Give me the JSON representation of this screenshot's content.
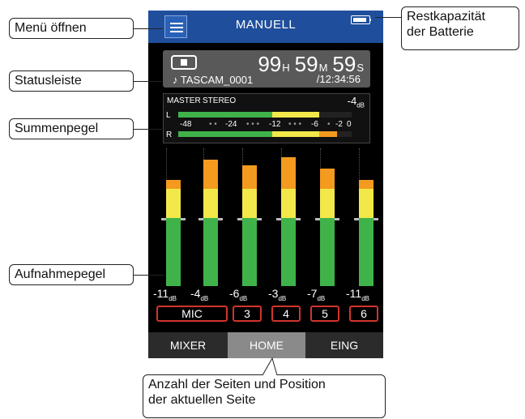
{
  "screen": {
    "title": "MANUELL",
    "time": {
      "h": "99",
      "h_unit": "H",
      "m": "59",
      "m_unit": "M",
      "s": "59",
      "s_unit": "S"
    },
    "file_name": "♪ TASCAM_0001",
    "total_time": "/12:34:56",
    "master": {
      "label": "MASTER",
      "mode": "STEREO",
      "level": "-4",
      "level_unit": "dB",
      "left_label": "L",
      "right_label": "R",
      "scale": [
        "-48",
        "-24",
        "-12",
        "-6",
        "-2",
        "0"
      ]
    },
    "channels": [
      {
        "value": "-11",
        "unit": "dB",
        "button": "MIC",
        "level": 0.0,
        "peak_db": -11
      },
      {
        "value": "-4",
        "unit": "dB",
        "button": "",
        "level": 0.0,
        "peak_db": -4
      },
      {
        "value": "-6",
        "unit": "dB",
        "button": "3",
        "level": 0.0,
        "peak_db": -6
      },
      {
        "value": "-3",
        "unit": "dB",
        "button": "4",
        "level": 0.0,
        "peak_db": -3
      },
      {
        "value": "-7",
        "unit": "dB",
        "button": "5",
        "level": 0.0,
        "peak_db": -7
      },
      {
        "value": "-11",
        "unit": "dB",
        "button": "6",
        "level": 0.0,
        "peak_db": -11
      }
    ],
    "tabs": [
      "MIXER",
      "HOME",
      "EING"
    ],
    "active_tab": "HOME"
  },
  "callouts": {
    "menu": "Menü öffnen",
    "battery": "Restkapazität\nder Batterie",
    "status": "Statusleiste",
    "master": "Summenpegel",
    "rec": "Aufnahmepegel",
    "pages": "Anzahl der Seiten und Position\nder aktuellen Seite"
  },
  "colors": {
    "header": "#1f4f9c",
    "green": "#3fb34a",
    "yellow": "#f2e84a",
    "orange": "#f39a1f",
    "red_border": "#d0342c"
  }
}
